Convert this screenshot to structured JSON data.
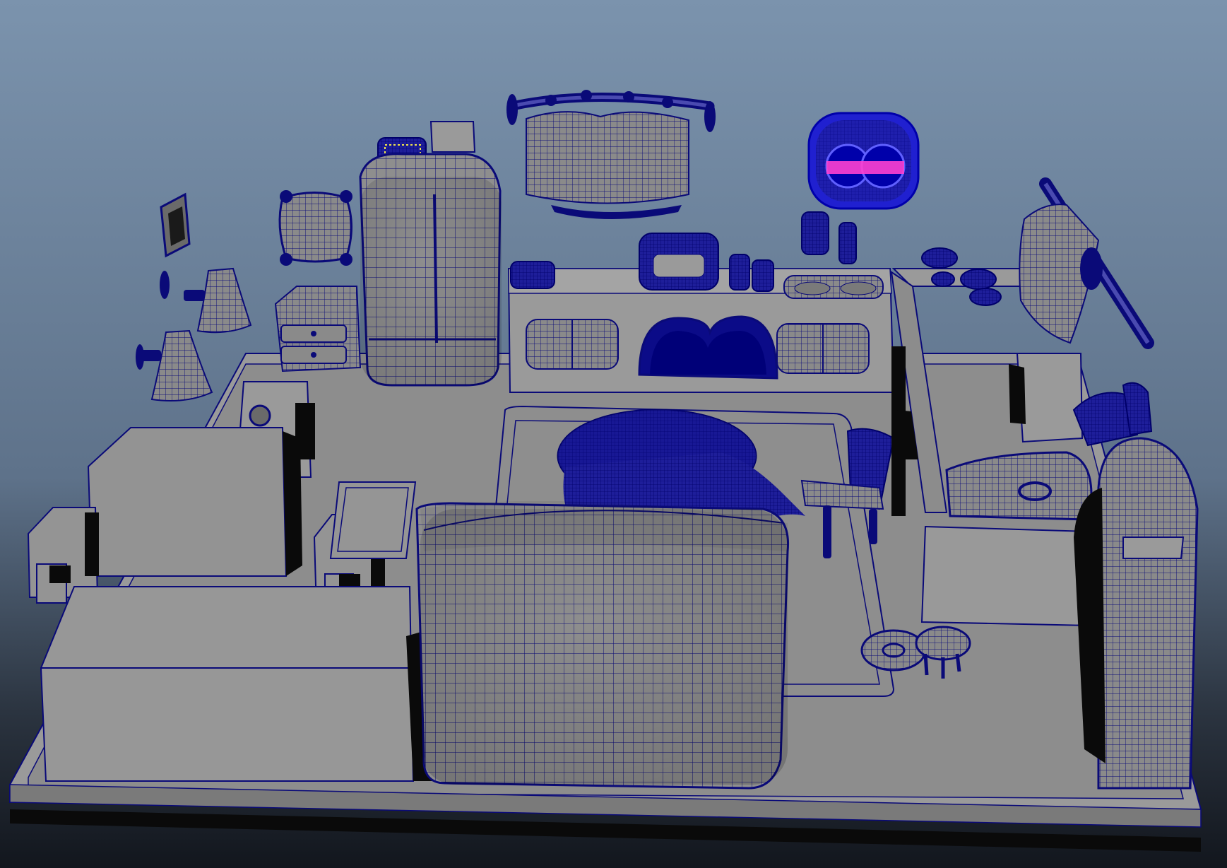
{
  "viewport": {
    "background_top": "#7b93ad",
    "background_bottom": "#1a1f27",
    "wireframe_color": "#0a0a78",
    "surface_color": "#8a8a8a",
    "surface_light": "#9b9b9b",
    "surface_dark": "#6f6f6f",
    "selection_color": "#2020d0",
    "highlight_color": "#ff40d0",
    "yellow_accent": "#f2e64a"
  },
  "scene": {
    "objects": [
      "room-base",
      "sofa",
      "tv-stand",
      "tv",
      "speaker-left",
      "speaker-right",
      "tray",
      "fridge",
      "nightstand",
      "picture-frame-small",
      "wall-lamps",
      "pillow",
      "radio",
      "sign-board",
      "curtain-rod",
      "curtain",
      "clock",
      "kitchen-counter",
      "sink",
      "cups",
      "rug",
      "round-table",
      "chair",
      "stools",
      "armchair",
      "shelf",
      "side-table",
      "arched-window",
      "hanging-blanket",
      "bowls",
      "cushion"
    ]
  }
}
